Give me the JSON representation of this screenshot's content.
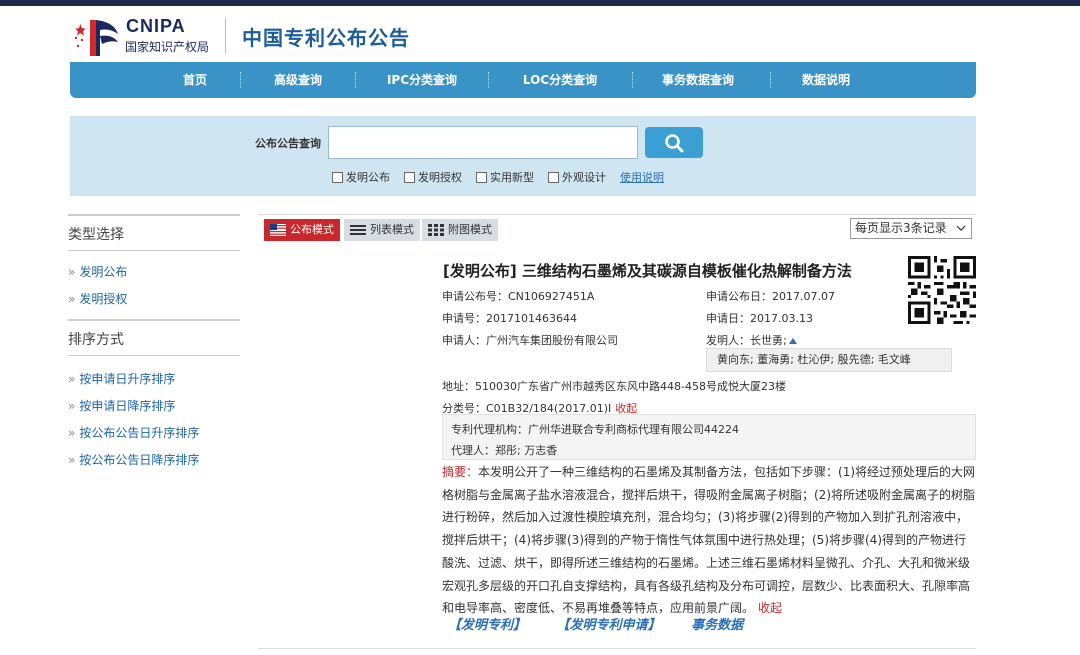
{
  "header": {
    "logo_en": "CNIPA",
    "logo_cn": "国家知识产权局",
    "site_title": "中国专利公布公告"
  },
  "nav": {
    "items": [
      "首页",
      "高级查询",
      "IPC分类查询",
      "LOC分类查询",
      "事务数据查询",
      "数据说明"
    ]
  },
  "search": {
    "label": "公布公告查询",
    "value": "",
    "placeholder": "",
    "filters": [
      "发明公布",
      "发明授权",
      "实用新型",
      "外观设计"
    ],
    "help": "使用说明"
  },
  "sidebar": {
    "type_title": "类型选择",
    "type_items": [
      "发明公布",
      "发明授权"
    ],
    "sort_title": "排序方式",
    "sort_items": [
      "按申请日升序排序",
      "按申请日降序排序",
      "按公布公告日升序排序",
      "按公布公告日降序排序"
    ]
  },
  "toolbar": {
    "modes": [
      "公布模式",
      "列表模式",
      "附图模式"
    ],
    "perpage": "每页显示3条记录"
  },
  "record": {
    "title": "[发明公布] 三维结构石墨烯及其碳源自模板催化热解制备方法",
    "pub_no_label": "申请公布号：",
    "pub_no": "CN106927451A",
    "pub_date_label": "申请公布日：",
    "pub_date": "2017.07.07",
    "app_no_label": "申请号：",
    "app_no": "2017101463644",
    "app_date_label": "申请日：",
    "app_date": "2017.03.13",
    "applicant_label": "申请人：",
    "applicant": "广州汽车集团股份有限公司",
    "inventor_label": "发明人：",
    "inventor": "长世勇;",
    "inventors_more": "黄向东; 董海勇; 杜沁伊; 殷先德; 毛文峰",
    "address_label": "地址：",
    "address": "510030广东省广州市越秀区东风中路448-458号成悦大厦23楼",
    "class_label": "分类号：",
    "class_no": "C01B32/184(2017.01)I",
    "collapse": "收起",
    "agency_label": "专利代理机构：",
    "agency": "广州华进联合专利商标代理有限公司44224",
    "agent_label": "代理人：",
    "agent": "郑彤; 万志香",
    "abstract_label": "摘要：",
    "abstract": "本发明公开了一种三维结构的石墨烯及其制备方法，包括如下步骤：(1)将经过预处理后的大网格树脂与金属离子盐水溶液混合，搅拌后烘干，得吸附金属离子树脂；(2)将所述吸附金属离子的树脂进行粉碎，然后加入过渡性模腔填充剂，混合均匀；(3)将步骤(2)得到的产物加入到扩孔剂溶液中，搅拌后烘干；(4)将步骤(3)得到的产物于惰性气体氛围中进行热处理；(5)将步骤(4)得到的产物进行酸洗、过滤、烘干，即得所述三维结构的石墨烯。上述三维石墨烯材料呈微孔、介孔、大孔和微米级宏观孔多层级的开口孔自支撑结构，具有各级孔结构及分布可调控，层数少、比表面积大、孔隙率高和电导率高、密度低、不易再堆叠等特点，应用前景广阔。",
    "abstract_collapse": "收起",
    "link1": "【发明专利】",
    "link2": "【发明专利申请】",
    "link3": "事务数据"
  },
  "colors": {
    "nav": "#3a93c6",
    "search_panel": "#cfe6f2",
    "active_mode": "#c8282b",
    "link": "#1d64a8",
    "title_blue": "#1d5c9b"
  },
  "icons": [
    "search-icon",
    "flag-icon",
    "list-icon",
    "grid-icon",
    "chevron-down-icon",
    "qr-code",
    "triangle-up-icon"
  ]
}
